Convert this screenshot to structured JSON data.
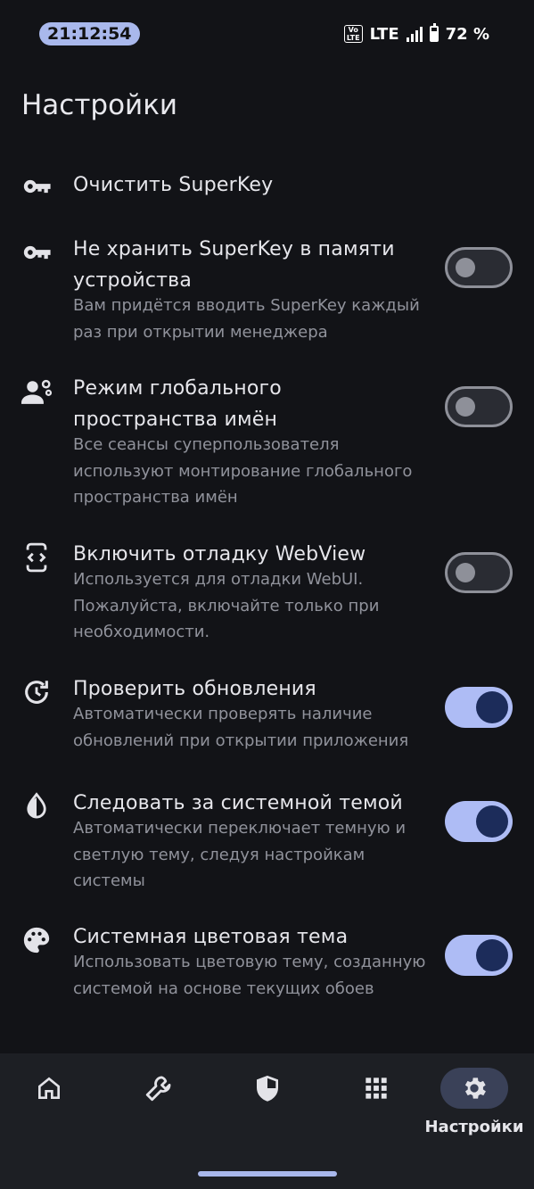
{
  "status_bar": {
    "time": "21:12:54",
    "volte": "Vo\nLTE",
    "network": "LTE",
    "battery": "72 %"
  },
  "page": {
    "title": "Настройки"
  },
  "settings": [
    {
      "title": "Очистить SuperKey",
      "description": "",
      "icon": "key-icon"
    },
    {
      "title": "Не хранить SuperKey в памяти устройства",
      "description": "Вам придётся вводить SuperKey каждый раз при открытии менеджера",
      "icon": "key-icon",
      "toggle": false
    },
    {
      "title": "Режим глобального пространства имён",
      "description": "Все сеансы суперпользователя используют монтирование глобального пространства имён",
      "icon": "user-settings-icon",
      "toggle": false
    },
    {
      "title": "Включить отладку WebView",
      "description": "Используется для отладки WebUI. Пожалуйста, включайте только при необходимости.",
      "icon": "developer-mode-icon",
      "toggle": false
    },
    {
      "title": "Проверить обновления",
      "description": "Автоматически проверять наличие обновлений при открытии приложения",
      "icon": "update-icon",
      "toggle": true
    },
    {
      "title": "Следовать за системной темой",
      "description": "Автоматически переключает темную и светлую тему, следуя настройкам системы",
      "icon": "contrast-drop-icon",
      "toggle": true
    },
    {
      "title": "Системная цветовая тема",
      "description": "Использовать цветовую тему, созданную системой на основе текущих обоев",
      "icon": "palette-icon",
      "toggle": true
    }
  ],
  "bottom_nav": {
    "items": [
      {
        "icon": "home-icon",
        "label": ""
      },
      {
        "icon": "wrench-icon",
        "label": ""
      },
      {
        "icon": "shield-icon",
        "label": ""
      },
      {
        "icon": "apps-grid-icon",
        "label": ""
      },
      {
        "icon": "gear-icon",
        "label": "Настройки",
        "active": true
      }
    ]
  },
  "colors": {
    "background": "#121317",
    "accent": "#aebcf5",
    "nav_background": "#1d1f24"
  }
}
